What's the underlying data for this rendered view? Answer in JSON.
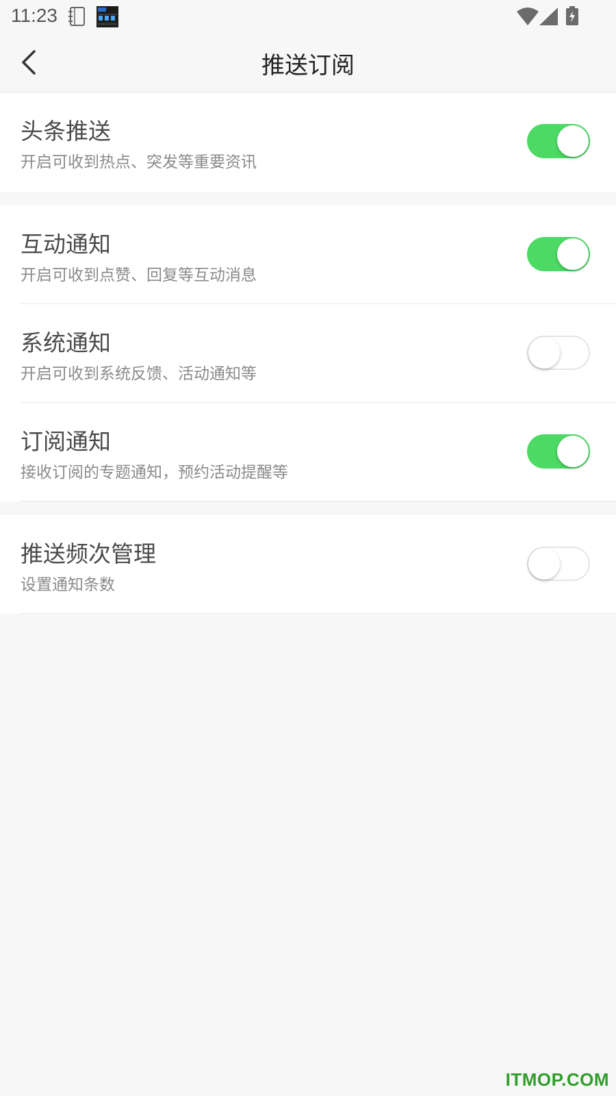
{
  "status_bar": {
    "time": "11:23",
    "icons": [
      "notebook-icon",
      "clock-widget-icon",
      "wifi-icon",
      "signal-icon",
      "battery-charging-icon"
    ]
  },
  "header": {
    "title": "推送订阅",
    "back_icon": "chevron-left-icon"
  },
  "settings": [
    {
      "title": "头条推送",
      "subtitle": "开启可收到热点、突发等重要资讯",
      "enabled": true
    },
    {
      "title": "互动通知",
      "subtitle": "开启可收到点赞、回复等互动消息",
      "enabled": true
    },
    {
      "title": "系统通知",
      "subtitle": "开启可收到系统反馈、活动通知等",
      "enabled": false
    },
    {
      "title": "订阅通知",
      "subtitle": "接收订阅的专题通知，预约活动提醒等",
      "enabled": true
    },
    {
      "title": "推送频次管理",
      "subtitle": "设置通知条数",
      "enabled": false
    }
  ],
  "colors": {
    "toggle_on": "#4cd964",
    "toggle_off_border": "#e5e5e5",
    "background": "#f7f7f7",
    "watermark": "#2f9e2a"
  },
  "watermark": "ITMOP.COM"
}
